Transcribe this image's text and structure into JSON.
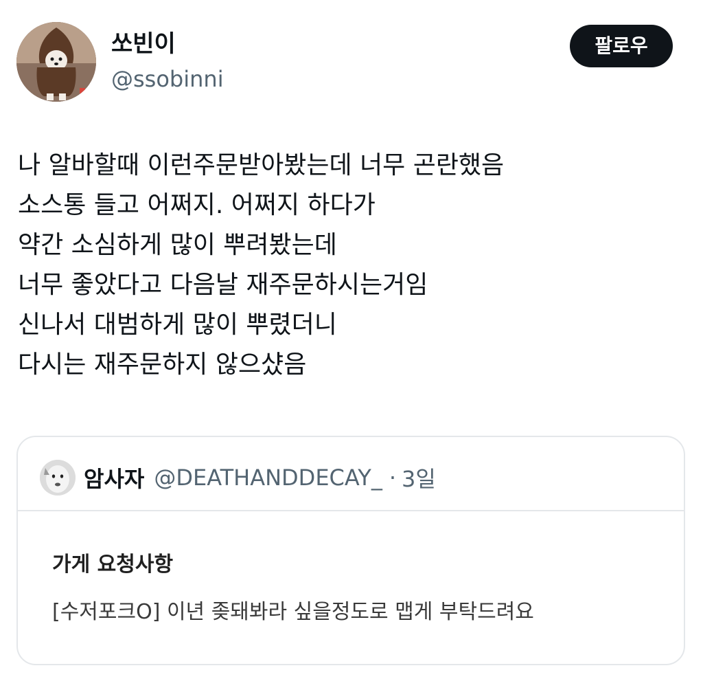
{
  "author": {
    "display_name": "쏘빈이",
    "handle": "@ssobinni",
    "follow_label": "팔로우"
  },
  "tweet": {
    "lines": [
      "나 알바할때 이런주문받아봤는데 너무 곤란했음",
      "소스통 들고 어쩌지. 어쩌지 하다가",
      "약간 소심하게 많이 뿌려봤는데",
      "너무 좋았다고 다음날 재주문하시는거임",
      "신나서 대범하게 많이 뿌렸더니",
      "다시는 재주문하지 않으샸음"
    ]
  },
  "quote": {
    "display_name": "암사자",
    "handle": "@DEATHANDDECAY_",
    "separator": "·",
    "time": "3일",
    "body_title": "가게 요청사항",
    "body_text": "[수저포크O] 이년 좆돼봐라 싶을정도로 맵게 부탁드려요"
  },
  "colors": {
    "text_primary": "#0f1419",
    "text_secondary": "#536471",
    "button_bg": "#0f1419",
    "button_text": "#ffffff",
    "border": "#e4e7ea"
  },
  "icons": {
    "author_avatar": "avatar-photo",
    "quote_avatar": "avatar-photo"
  }
}
